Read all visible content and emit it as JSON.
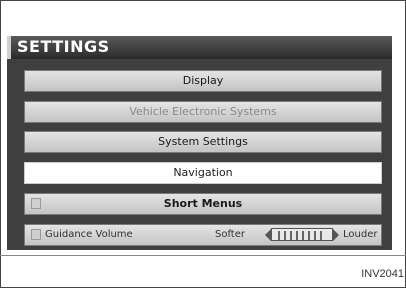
{
  "screen": {
    "title": "SETTINGS",
    "menu": [
      {
        "label": "Display",
        "state": "normal",
        "bold": false
      },
      {
        "label": "Vehicle Electronic Systems",
        "state": "disabled",
        "bold": false
      },
      {
        "label": "System Settings",
        "state": "normal",
        "bold": false
      },
      {
        "label": "Navigation",
        "state": "selected",
        "bold": false
      },
      {
        "label": "Short Menus",
        "state": "normal",
        "bold": true
      }
    ],
    "guidance_volume": {
      "label": "Guidance Volume",
      "softer_label": "Softer",
      "louder_label": "Louder",
      "level_fraction": 0.5
    }
  },
  "figure_code": "INV2041"
}
